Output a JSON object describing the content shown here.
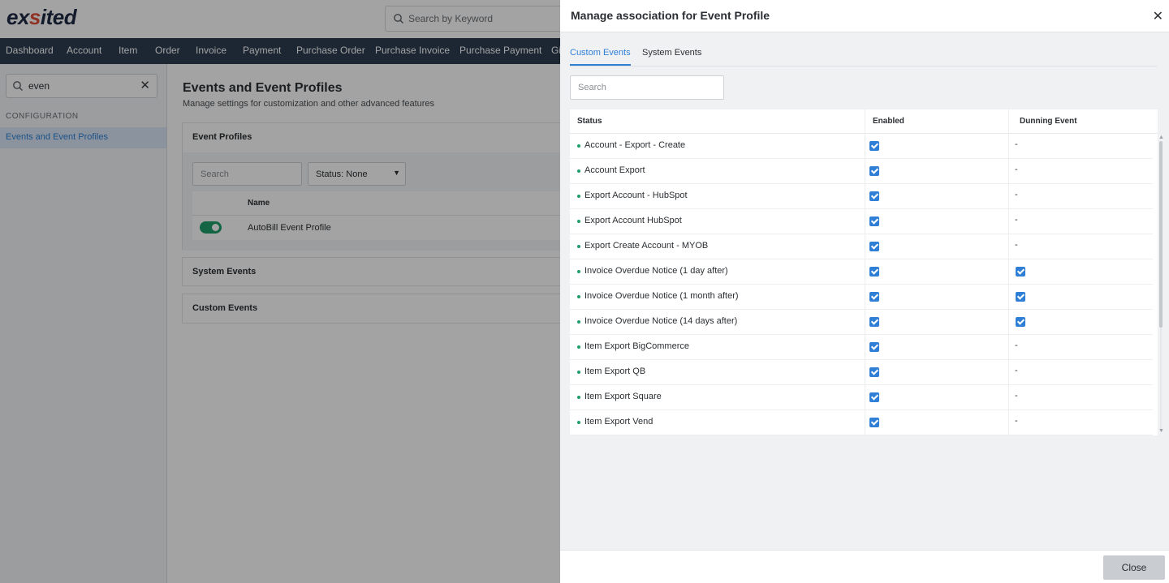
{
  "app": {
    "logo": {
      "part1": "ex",
      "accent": "s",
      "part2": "ited"
    },
    "keyword_search": {
      "placeholder": "Search by Keyword",
      "icon": "search-icon"
    },
    "nav": [
      "Dashboard",
      "Account",
      "Item",
      "Order",
      "Invoice",
      "Payment",
      "Purchase Order",
      "Purchase Invoice",
      "Purchase Payment",
      "Gi"
    ]
  },
  "sidebar": {
    "search_value": "even",
    "clear_label": "✕",
    "section_label": "CONFIGURATION",
    "items": [
      {
        "label": "Events and Event Profiles",
        "selected": true
      }
    ]
  },
  "main": {
    "title": "Events and Event Profiles",
    "subtitle": "Manage settings for customization and other advanced features",
    "event_profiles": {
      "header": "Event Profiles",
      "search_placeholder": "Search",
      "status_filter": "Status: None",
      "column_name": "Name",
      "rows": [
        {
          "name": "AutoBill Event Profile",
          "enabled": true
        }
      ]
    },
    "system_events_header": "System Events",
    "custom_events_header": "Custom Events"
  },
  "drawer": {
    "title": "Manage association for Event Profile",
    "close_icon": "✕",
    "tabs": [
      {
        "label": "Custom Events",
        "active": true
      },
      {
        "label": "System Events",
        "active": false
      }
    ],
    "search_placeholder": "Search",
    "columns": {
      "status": "Status",
      "enabled": "Enabled",
      "dunning": "Dunning Event"
    },
    "rows": [
      {
        "name": "Account - Export - Create",
        "enabled": true,
        "dunning": "-"
      },
      {
        "name": "Account Export",
        "enabled": true,
        "dunning": "-"
      },
      {
        "name": "Export Account - HubSpot",
        "enabled": true,
        "dunning": "-"
      },
      {
        "name": "Export Account HubSpot",
        "enabled": true,
        "dunning": "-"
      },
      {
        "name": "Export Create Account - MYOB",
        "enabled": true,
        "dunning": "-"
      },
      {
        "name": "Invoice Overdue Notice (1 day after)",
        "enabled": true,
        "dunning": true
      },
      {
        "name": "Invoice Overdue Notice (1 month after)",
        "enabled": true,
        "dunning": true
      },
      {
        "name": "Invoice Overdue Notice (14 days after)",
        "enabled": true,
        "dunning": true
      },
      {
        "name": "Item Export BigCommerce",
        "enabled": true,
        "dunning": "-"
      },
      {
        "name": "Item Export QB",
        "enabled": true,
        "dunning": "-"
      },
      {
        "name": "Item Export Square",
        "enabled": true,
        "dunning": "-"
      },
      {
        "name": "Item Export Vend",
        "enabled": true,
        "dunning": "-"
      }
    ],
    "close_button": "Close"
  },
  "colors": {
    "accent": "#2f7fd6",
    "nav_bg": "#2c3e50",
    "status_dot": "#1e9e6b",
    "logo_accent": "#e34d3c"
  }
}
